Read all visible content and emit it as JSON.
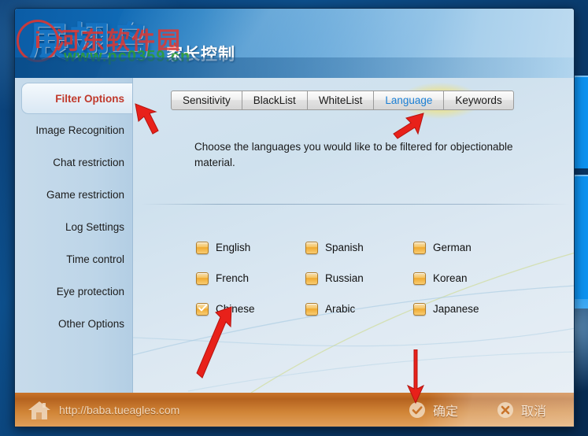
{
  "header": {
    "brand_logo": "展翅鸟",
    "subtitle": "家长控制",
    "watermark_badge": "i",
    "watermark_red": "河东软件园",
    "watermark_green": "www.pc0359.cn"
  },
  "sidebar": {
    "items": [
      {
        "label": "Filter Options",
        "active": true
      },
      {
        "label": "Image Recognition",
        "active": false
      },
      {
        "label": "Chat restriction",
        "active": false
      },
      {
        "label": "Game restriction",
        "active": false
      },
      {
        "label": "Log Settings",
        "active": false
      },
      {
        "label": "Time control",
        "active": false
      },
      {
        "label": "Eye protection",
        "active": false
      },
      {
        "label": "Other Options",
        "active": false
      }
    ]
  },
  "tabs": [
    {
      "label": "Sensitivity",
      "active": false
    },
    {
      "label": "BlackList",
      "active": false
    },
    {
      "label": "WhiteList",
      "active": false
    },
    {
      "label": "Language",
      "active": true
    },
    {
      "label": "Keywords",
      "active": false
    }
  ],
  "content": {
    "instructions": "Choose the languages you would like to be filtered for objectionable material.",
    "languages": [
      {
        "label": "English",
        "checked": false
      },
      {
        "label": "Spanish",
        "checked": false
      },
      {
        "label": "German",
        "checked": false
      },
      {
        "label": "French",
        "checked": false
      },
      {
        "label": "Russian",
        "checked": false
      },
      {
        "label": "Korean",
        "checked": false
      },
      {
        "label": "Chinese",
        "checked": true
      },
      {
        "label": "Arabic",
        "checked": false
      },
      {
        "label": "Japanese",
        "checked": false
      }
    ]
  },
  "footer": {
    "url": "http://baba.tueagles.com",
    "ok_label": "确定",
    "cancel_label": "取消"
  },
  "colors": {
    "accent_orange": "#f0a92f",
    "header_blue": "#0f69b4",
    "active_tab_text": "#1b7fd4",
    "active_sidebar_text": "#c0392b",
    "footer_orange": "#c9742a",
    "annotation_red": "#e8211a",
    "tab_highlight_yellow": "#ffe246"
  }
}
